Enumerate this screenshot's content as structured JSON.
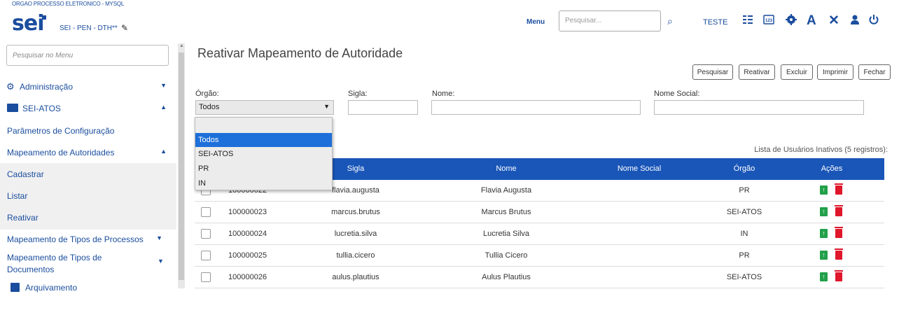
{
  "header": {
    "org_name": "ORGAO PROCESSO ELETRONICO - MYSQL",
    "logo_text": "sei",
    "system_label": "SEI - PEN - DTH**",
    "menu_label": "Menu",
    "search_placeholder": "Pesquisar...",
    "user_label": "TESTE",
    "icons": [
      "grid-icon",
      "calendar-icon",
      "gear-icon",
      "font-icon",
      "tools-icon",
      "user-icon",
      "power-icon"
    ]
  },
  "sidebar": {
    "search_placeholder": "Pesquisar no Menu",
    "items": [
      {
        "label": "Administração",
        "icon": "gears-icon",
        "caret": "down"
      },
      {
        "label": "SEI-ATOS",
        "icon": "folder-icon",
        "caret": "up"
      },
      {
        "label": "Parâmetros de Configuração"
      },
      {
        "label": "Mapeamento de Autoridades",
        "caret": "up"
      },
      {
        "label": "Cadastrar"
      },
      {
        "label": "Listar"
      },
      {
        "label": "Reativar"
      },
      {
        "label": "Mapeamento de Tipos de Processos",
        "caret": "down"
      },
      {
        "label": "Mapeamento de Tipos de Documentos",
        "caret": "down"
      },
      {
        "label": "Arquivamento",
        "icon": "archive-icon"
      }
    ]
  },
  "page": {
    "title": "Reativar Mapeamento de Autoridade",
    "buttons": [
      "Pesquisar",
      "Reativar",
      "Excluir",
      "Imprimir",
      "Fechar"
    ],
    "filters": {
      "orgao_label": "Órgão:",
      "orgao_value": "Todos",
      "orgao_options": [
        "",
        "Todos",
        "SEI-ATOS",
        "PR",
        "IN"
      ],
      "sigla_label": "Sigla:",
      "nome_label": "Nome:",
      "nome_social_label": "Nome Social:"
    },
    "list_caption": "Lista de Usuários Inativos (5 registros):",
    "table": {
      "headers": [
        "Sigla",
        "Nome",
        "Nome Social",
        "Órgão",
        "Ações"
      ],
      "rows": [
        {
          "id": "100000022",
          "sigla": "flavia.augusta",
          "nome": "Flavia Augusta",
          "nome_social": "",
          "orgao": "PR"
        },
        {
          "id": "100000023",
          "sigla": "marcus.brutus",
          "nome": "Marcus Brutus",
          "nome_social": "",
          "orgao": "SEI-ATOS"
        },
        {
          "id": "100000024",
          "sigla": "lucretia.silva",
          "nome": "Lucretia Silva",
          "nome_social": "",
          "orgao": "IN"
        },
        {
          "id": "100000025",
          "sigla": "tullia.cicero",
          "nome": "Tullia Cicero",
          "nome_social": "",
          "orgao": "PR"
        },
        {
          "id": "100000026",
          "sigla": "aulus.plautius",
          "nome": "Aulus Plautius",
          "nome_social": "",
          "orgao": "SEI-ATOS"
        }
      ]
    }
  },
  "colors": {
    "brand": "#1a4d9e",
    "table_header": "#1a56b8",
    "action_reativar": "#22a04a",
    "action_excluir": "#e0162b",
    "dropdown_selected": "#1d6fd9"
  }
}
